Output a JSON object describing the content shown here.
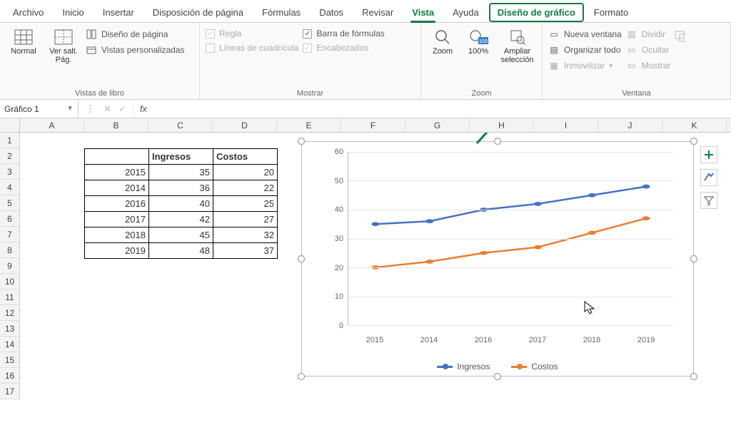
{
  "tabs": {
    "file": "Archivo",
    "home": "Inicio",
    "insert": "Insertar",
    "pagelayout": "Disposición de página",
    "formulas": "Fórmulas",
    "data": "Datos",
    "review": "Revisar",
    "view": "Vista",
    "help": "Ayuda",
    "chartdesign": "Diseño de gráfico",
    "format": "Formato"
  },
  "ribbon": {
    "views": {
      "normal": "Normal",
      "pagebreak": "Ver salt. Pág.",
      "pagelayout": "Diseño de página",
      "custom": "Vistas personalizadas",
      "group": "Vistas de libro"
    },
    "show": {
      "ruler": "Regla",
      "gridlines": "Líneas de cuadrícula",
      "formulabar": "Barra de fórmulas",
      "headings": "Encabezados",
      "group": "Mostrar"
    },
    "zoom": {
      "zoom": "Zoom",
      "hundred": "100%",
      "selection": "Ampliar selección",
      "group": "Zoom"
    },
    "window": {
      "new": "Nueva ventana",
      "arrange": "Organizar todo",
      "freeze": "Inmovilizar",
      "split": "Dividir",
      "hide": "Ocultar",
      "show": "Mostrar",
      "group": "Ventana"
    }
  },
  "namebox": "Gráfico 1",
  "fx_label": "fx",
  "columns": [
    "A",
    "B",
    "C",
    "D",
    "E",
    "F",
    "G",
    "H",
    "I",
    "J",
    "K"
  ],
  "row_count": 17,
  "table": {
    "headers": {
      "col_b": "",
      "col_c": "Ingresos",
      "col_d": "Costos"
    },
    "rows": [
      {
        "year": "2015",
        "ingresos": "35",
        "costos": "20"
      },
      {
        "year": "2014",
        "ingresos": "36",
        "costos": "22"
      },
      {
        "year": "2016",
        "ingresos": "40",
        "costos": "25"
      },
      {
        "year": "2017",
        "ingresos": "42",
        "costos": "27"
      },
      {
        "year": "2018",
        "ingresos": "45",
        "costos": "32"
      },
      {
        "year": "2019",
        "ingresos": "48",
        "costos": "37"
      }
    ]
  },
  "chart_data": {
    "type": "line",
    "categories": [
      "2015",
      "2014",
      "2016",
      "2017",
      "2018",
      "2019"
    ],
    "series": [
      {
        "name": "Ingresos",
        "values": [
          35,
          36,
          40,
          42,
          45,
          48
        ],
        "color": "#4472c4"
      },
      {
        "name": "Costos",
        "values": [
          20,
          22,
          25,
          27,
          32,
          37
        ],
        "color": "#ed7d31"
      }
    ],
    "ylim": [
      0,
      60
    ],
    "yticks": [
      0,
      10,
      20,
      30,
      40,
      50,
      60
    ],
    "xlabel": "",
    "ylabel": "",
    "title": "",
    "legend_position": "bottom",
    "grid": true
  }
}
